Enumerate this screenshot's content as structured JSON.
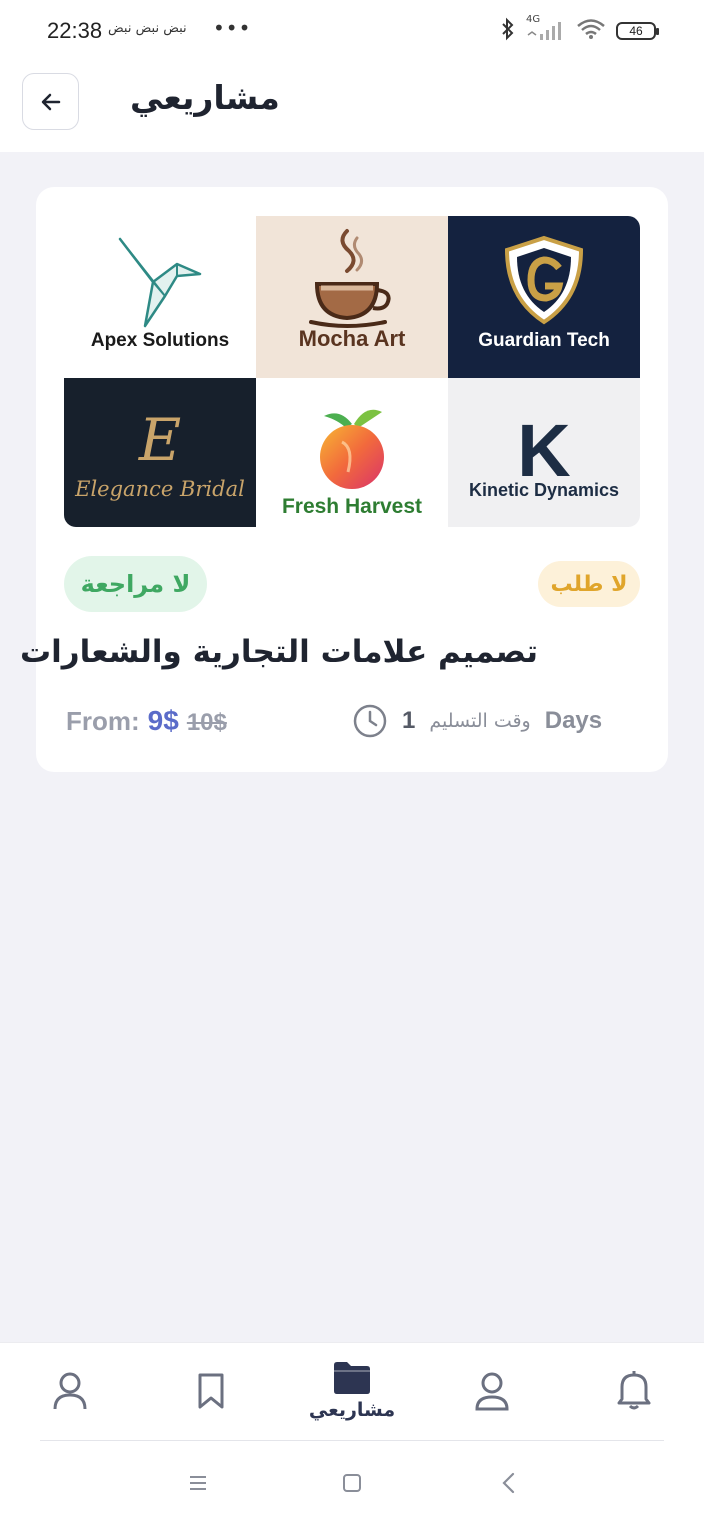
{
  "status_bar": {
    "time": "22:38",
    "notifications": "نبض نبض نبض",
    "more": "•••",
    "network": "4G",
    "battery": "46"
  },
  "header": {
    "title": "مشاريعي",
    "back_icon": "arrow-left-icon"
  },
  "project_card": {
    "logos": [
      {
        "name": "Apex Solutions",
        "bg": "#ffffff",
        "color": "#1a1a1a"
      },
      {
        "name": "Mocha Art",
        "bg": "#f1e4d8",
        "color": "#5a3420"
      },
      {
        "name": "Guardian Tech",
        "bg": "#14223f",
        "color": "#ffffff"
      },
      {
        "name": "Elegance Bridal",
        "bg": "#17202c",
        "color": "#c9a46a"
      },
      {
        "name": "Fresh Harvest",
        "bg": "#ffffff",
        "color": "#2e7d32"
      },
      {
        "name": "Kinetic Dynamics",
        "bg": "#f0f0f2",
        "color": "#1d2d44"
      }
    ],
    "elegance_initial": "E",
    "kinetic_initial": "K",
    "review_badge": "لا مراجعة",
    "order_badge": "لا طلب",
    "title": "تصميم علامات التجارية والشعارات",
    "price_from_label": "From:",
    "price_current": "9$",
    "price_original": "10$",
    "delivery_label": "وقت التسليم",
    "delivery_value": "1",
    "delivery_unit": "Days",
    "colors": {
      "price_accent": "#5b6cc9",
      "review_green": "#3fa862",
      "order_amber": "#e0a52b"
    }
  },
  "bottom_nav": {
    "items": [
      {
        "icon": "user-icon",
        "label": ""
      },
      {
        "icon": "bookmark-icon",
        "label": ""
      },
      {
        "icon": "folder-icon",
        "label": "مشاريعي"
      },
      {
        "icon": "user-icon",
        "label": ""
      },
      {
        "icon": "bell-icon",
        "label": ""
      }
    ]
  },
  "system_nav": [
    "menu-icon",
    "home-square-icon",
    "back-chevron-icon"
  ]
}
